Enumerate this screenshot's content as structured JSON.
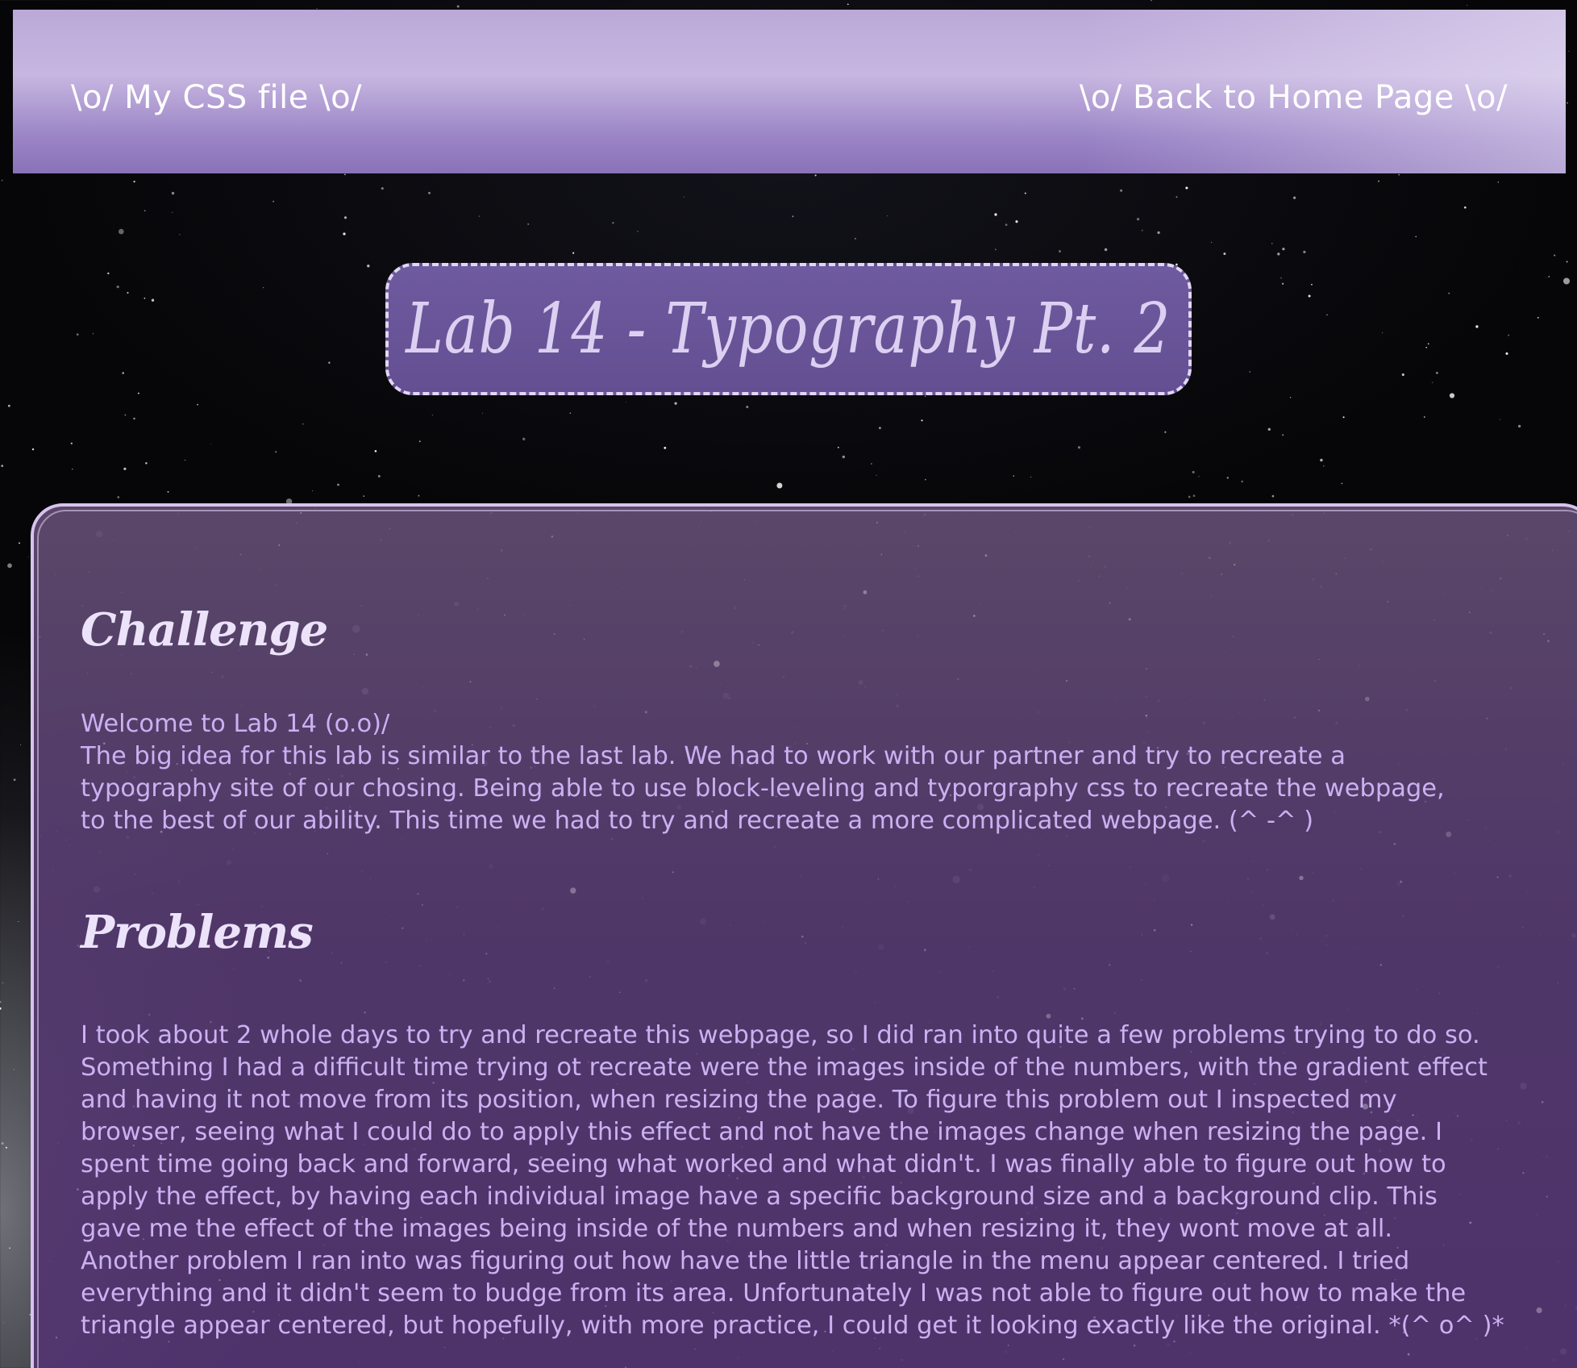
{
  "nav": {
    "css_link": "\\o/ My CSS file \\o/",
    "home_link": "\\o/ Back to Home Page \\o/"
  },
  "title": "Lab 14 - Typography Pt. 2",
  "sections": {
    "challenge": {
      "heading": "Challenge",
      "lines": [
        "Welcome to Lab 14 (o.o)/",
        "The big idea for this lab is similar to the last lab. We had to work with our partner and try to recreate a",
        "typography site of our chosing. Being able to use block-leveling and typorgraphy css to recreate the webpage,",
        "to the best of our ability. This time we had to try and recreate a more complicated webpage. (^ -^ )"
      ]
    },
    "problems": {
      "heading": "Problems",
      "lines": [
        "I took about 2 whole days to try and recreate this webpage, so I did ran into quite a few problems trying to do so.",
        "Something I had a difficult time trying ot recreate were the images inside of the numbers, with the gradient effect",
        "and having it not move from its position, when resizing the page. To figure this problem out I inspected my",
        "browser, seeing what I could do to apply this effect and not have the images change when resizing the page. I",
        "spent time going back and forward, seeing what worked and what didn't. I was finally able to figure out how to",
        "apply the effect, by having each individual image have a specific background size and a background clip. This",
        "gave me the effect of the images being inside of the numbers and when resizing it, they wont move at all.",
        "Another problem I ran into was figuring out how have the little triangle in the menu appear centered. I tried",
        "everything and it didn't seem to budge from its area. Unfortunately I was not able to figure out how to make the",
        "triangle appear centered, but hopefully, with more practice, I could get it looking exactly like the original. *(^ o^ )*"
      ]
    }
  },
  "colors": {
    "nav_bar": "#bba8d8",
    "title_box": "#6a5698",
    "panel": "#5a3e74",
    "body_text": "#cbb1f2",
    "heading_text": "#ece2fa"
  }
}
